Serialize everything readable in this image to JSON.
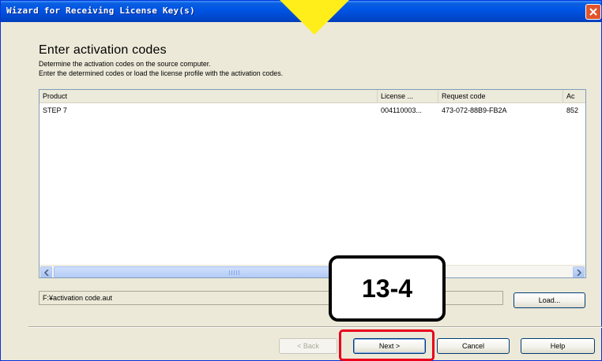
{
  "window": {
    "title": "Wizard for Receiving License Key(s)"
  },
  "page": {
    "heading": "Enter activation codes",
    "description_line1": "Determine the activation codes on the source computer.",
    "description_line2": "Enter the determined codes or load the license profile with the activation codes."
  },
  "table": {
    "columns": [
      "Product",
      "License ...",
      "Request code",
      "Ac"
    ],
    "rows": [
      {
        "product": "STEP 7",
        "license": "004110003...",
        "request_code": "473-072-88B9-FB2A",
        "activation": "852"
      }
    ]
  },
  "file_path": "F:¥activation code.aut",
  "buttons": {
    "load": "Load...",
    "back": "< Back",
    "next": "Next >",
    "cancel": "Cancel",
    "help": "Help"
  },
  "annotation": {
    "step_label": "13-4"
  },
  "colors": {
    "highlight": "#e8001c",
    "arrow": "#ffee1a",
    "titlebar": "#0055e5"
  },
  "icons": [
    "close-icon",
    "scroll-left-icon",
    "scroll-right-icon",
    "down-arrow-icon"
  ]
}
